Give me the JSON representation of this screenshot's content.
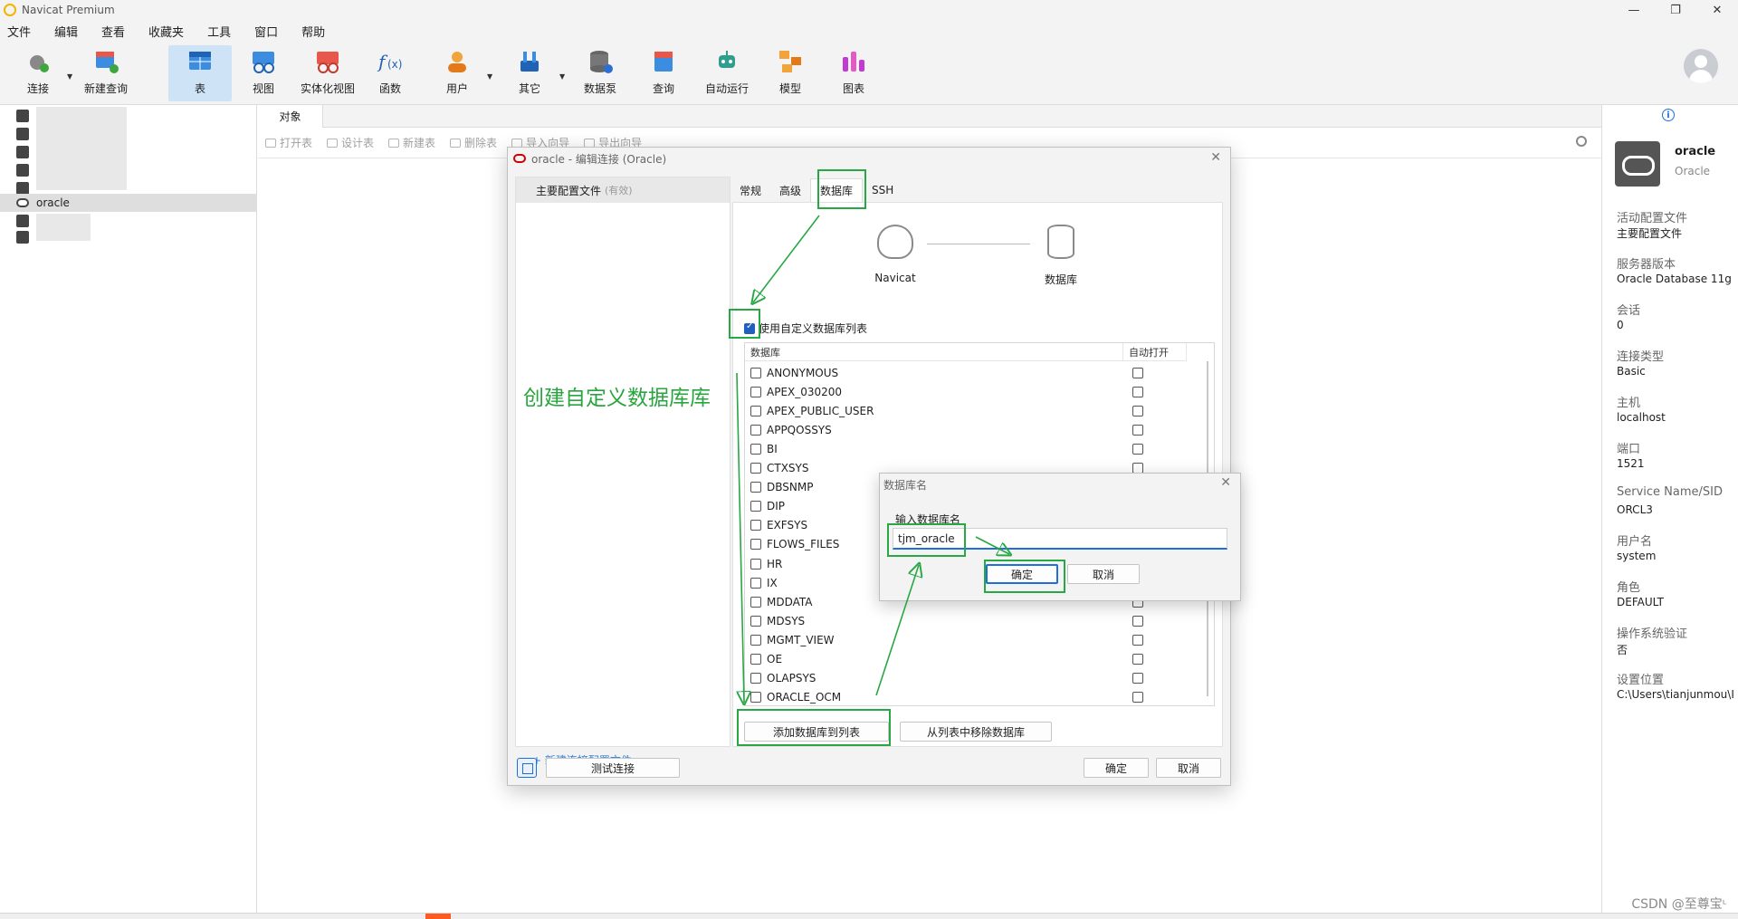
{
  "titlebar": {
    "title": "Navicat Premium",
    "minimize": "—",
    "maximize": "❐",
    "close": "✕"
  },
  "menubar": {
    "items": [
      "文件",
      "编辑",
      "查看",
      "收藏夹",
      "工具",
      "窗口",
      "帮助"
    ]
  },
  "toolbar": {
    "connect": "连接",
    "new_query": "新建查询",
    "table": "表",
    "view": "视图",
    "mat_view": "实体化视图",
    "function": "函数",
    "user": "用户",
    "other": "其它",
    "data_pump": "数据泵",
    "query": "查询",
    "auto_run": "自动运行",
    "model": "模型",
    "chart": "图表"
  },
  "navtree": {
    "selected": "oracle"
  },
  "object_tab": "对象",
  "object_toolbar": {
    "open": "打开表",
    "design": "设计表",
    "new": "新建表",
    "delete": "删除表",
    "import": "导入向导",
    "export": "导出向导"
  },
  "info": {
    "name": "oracle",
    "type": "Oracle",
    "fields": [
      {
        "key": "活动配置文件",
        "value": "主要配置文件"
      },
      {
        "key": "服务器版本",
        "value": "Oracle Database 11g"
      },
      {
        "key": "会话",
        "value": "0"
      },
      {
        "key": "连接类型",
        "value": "Basic"
      },
      {
        "key": "主机",
        "value": "localhost"
      },
      {
        "key": "端口",
        "value": "1521"
      },
      {
        "key": "Service Name/SID",
        "value": "ORCL3"
      },
      {
        "key": "用户名",
        "value": "system"
      },
      {
        "key": "角色",
        "value": "DEFAULT"
      },
      {
        "key": "操作系统验证",
        "value": "否"
      },
      {
        "key": "设置位置",
        "value": "C:\\Users\\tianjunmou\\I"
      }
    ]
  },
  "dialog": {
    "title": "oracle - 编辑连接 (Oracle)",
    "profile": "主要配置文件",
    "profile_state": "(有效)",
    "new_profile": "+ 新建连接配置文件",
    "tabs": [
      "常规",
      "高级",
      "数据库",
      "SSH"
    ],
    "navicat_label": "Navicat",
    "database_label": "数据库",
    "use_custom_list": "使用自定义数据库列表",
    "col_db": "数据库",
    "col_auto": "自动打开",
    "databases": [
      "ANONYMOUS",
      "APEX_030200",
      "APEX_PUBLIC_USER",
      "APPQOSSYS",
      "BI",
      "CTXSYS",
      "DBSNMP",
      "DIP",
      "EXFSYS",
      "FLOWS_FILES",
      "HR",
      "IX",
      "MDDATA",
      "MDSYS",
      "MGMT_VIEW",
      "OE",
      "OLAPSYS",
      "ORACLE_OCM"
    ],
    "add_btn": "添加数据库到列表",
    "remove_btn": "从列表中移除数据库",
    "test_btn": "测试连接",
    "ok_btn": "确定",
    "cancel_btn": "取消"
  },
  "subdialog": {
    "title": "数据库名",
    "label": "输入数据库名",
    "value": "tjm_oracle",
    "ok": "确定",
    "cancel": "取消"
  },
  "annotation": {
    "text": "创建自定义数据库库",
    "color": "#28a745"
  },
  "watermark": "CSDN @至尊宝ᶫ"
}
